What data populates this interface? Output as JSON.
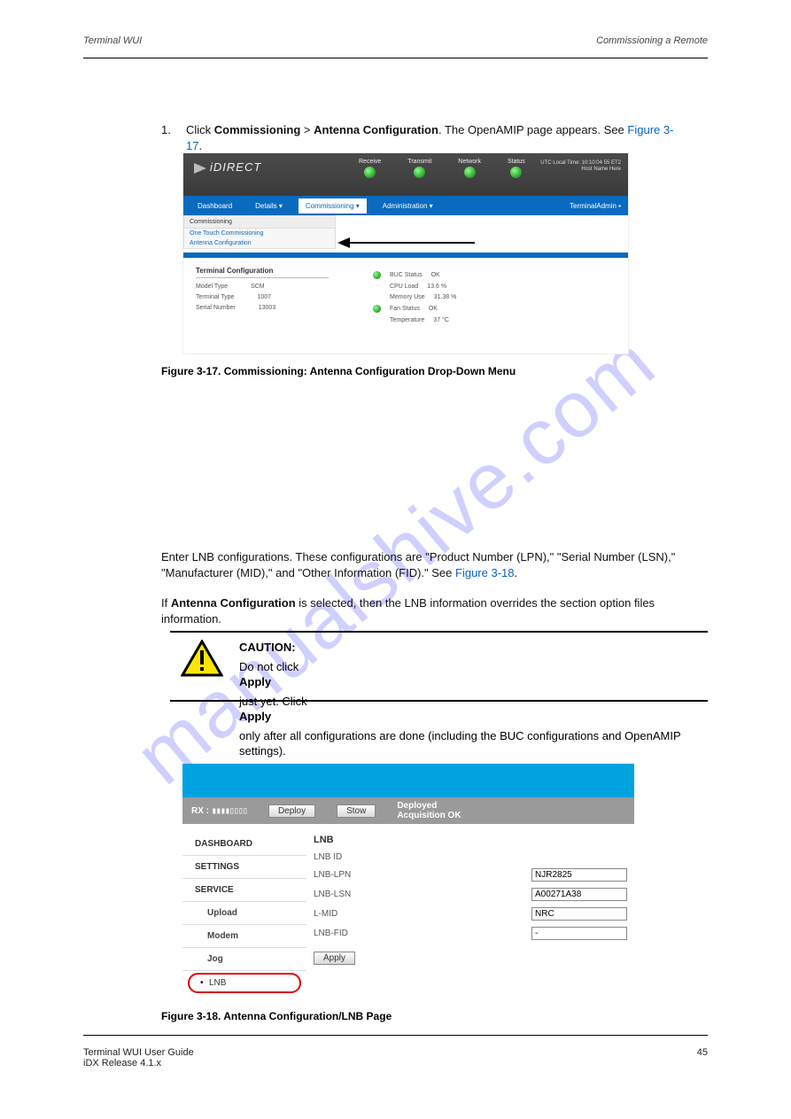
{
  "header": {
    "left": "Terminal WUI",
    "right": "Commissioning a Remote"
  },
  "footer": {
    "left": "Terminal WUI User Guide\niDX Release 4.1.x",
    "right": "45"
  },
  "watermark": "manualshive.com",
  "para1_num": "1.",
  "para1": "Click Commissioning > Antenna Configuration. The OpenAMIP page appears. See Figure 3-17.",
  "fig1cap": "Figure 3-17. Commissioning: Antenna Configuration Drop-Down Menu",
  "para2": "Enter LNB configurations. These configurations are \"Product Number (LPN),\" \"Serial Number (LSN),\" \"Manufacturer (MID),\" and \"Other Information (FID).\" See Figure 3-18.",
  "para3a": "If ",
  "para3b": "Antenna Configuration",
  "para3c": " is selected, then the LNB information overrides the section option files information.",
  "caution": {
    "title": "CAUTION:",
    "body": "Do not click Apply just yet. Click Apply only after all configurations are done (including the BUC configurations and OpenAMIP settings)."
  },
  "fig2cap": "Figure 3-18. Antenna Configuration/LNB Page",
  "idirect": {
    "logo_text": "iDIRECT",
    "leds": [
      "Receive",
      "Transmit",
      "Network",
      "Status"
    ],
    "clock_1": "UTC Local Time: 10:10:04 55 ET2",
    "clock_2": "Host Name Here",
    "nav": {
      "dashboard": "Dashboard",
      "details": "Details ▾",
      "commissioning": "Commissioning ▾",
      "admin": "Administration ▾",
      "adm": "TerminalAdmin  ▪"
    },
    "drop": {
      "header": "Commissioning",
      "one_touch": "One Touch Commissioning",
      "antenna": "Antenna Configuration"
    },
    "panel_title": "Terminal Configuration",
    "kv": [
      [
        "Model Type",
        "SCM"
      ],
      [
        "Terminal Type",
        "1007"
      ],
      [
        "Serial Number",
        "13003"
      ]
    ],
    "right": [
      [
        "●",
        "BUC Status",
        "OK"
      ],
      [
        "",
        "CPU Load",
        "13.6 %"
      ],
      [
        "",
        "Memory Use",
        "31.38 %"
      ],
      [
        "●",
        "Fan Status",
        "OK"
      ],
      [
        "",
        "Temperature",
        "37 °C"
      ]
    ]
  },
  "lnb": {
    "rx_label": "RX :",
    "signal": "▮▮▮▮▯▯▯▯",
    "deploy": "Deploy",
    "stow": "Stow",
    "status1": "Deployed",
    "status2": "Acquisition OK",
    "side": [
      "DASHBOARD",
      "SETTINGS",
      "SERVICE"
    ],
    "side_sub": [
      "Upload",
      "Modem",
      "Jog",
      "LNB"
    ],
    "title": "LNB",
    "idlabel": "LNB ID",
    "rows": [
      {
        "k": "LNB-LPN",
        "v": "NJR2825"
      },
      {
        "k": "LNB-LSN",
        "v": "A00271A38"
      },
      {
        "k": "L-MID",
        "v": "NRC"
      },
      {
        "k": "LNB-FID",
        "v": "-"
      }
    ],
    "apply": "Apply"
  }
}
